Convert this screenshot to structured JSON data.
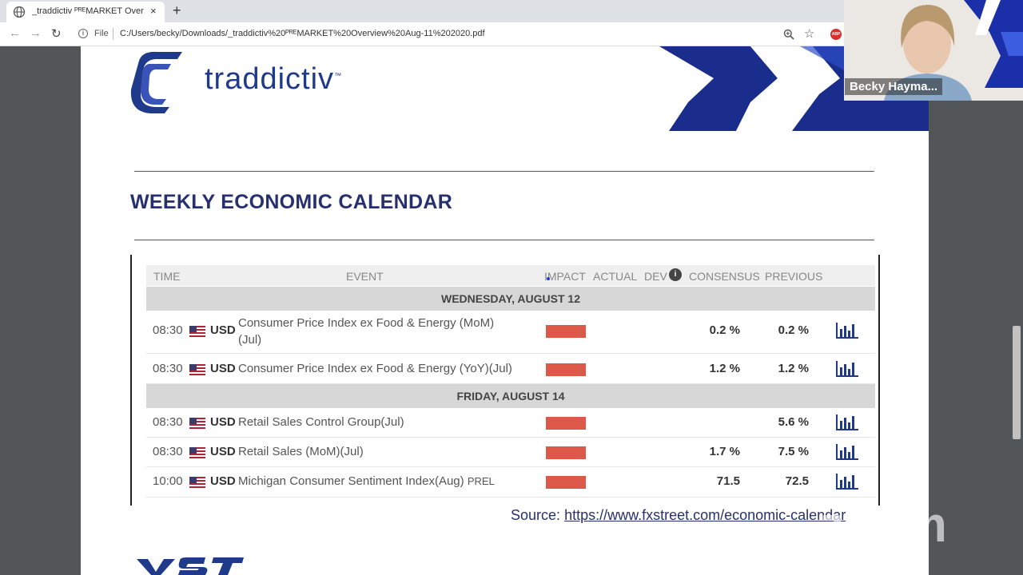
{
  "browser": {
    "tab_title": "_traddictiv ᴾᴿᴱMARKET Overview A",
    "tab_close": "×",
    "new_tab": "+",
    "back": "←",
    "forward": "→",
    "reload": "↻",
    "address_scheme": "File",
    "address_url": "C:/Users/becky/Downloads/_traddictiv%20ᴾᴿᴱMARKET%20Overview%20Aug-11%202020.pdf",
    "abp_label": "ABP"
  },
  "page": {
    "logo_text": "traddictiv",
    "logo_tm": "™",
    "heading": "WEEKLY ECONOMIC CALENDAR",
    "source_label": "Source:",
    "source_url": "https://www.fxstreet.com/economic-calendar"
  },
  "calendar": {
    "headers": {
      "time": "TIME",
      "event": "EVENT",
      "impact": "IMPACT",
      "actual": "ACTUAL",
      "dev": "DEV",
      "consensus": "CONSENSUS",
      "previous": "PREVIOUS"
    },
    "days": [
      {
        "label": "WEDNESDAY, AUGUST 12",
        "events": [
          {
            "time": "08:30",
            "currency": "USD",
            "event": "Consumer Price Index ex Food & Energy (MoM)",
            "event_line2": "(Jul)",
            "tag": "",
            "consensus": "0.2 %",
            "previous": "0.2 %"
          },
          {
            "time": "08:30",
            "currency": "USD",
            "event": "Consumer Price Index ex Food & Energy (YoY)(Jul)",
            "event_line2": "",
            "tag": "",
            "consensus": "1.2 %",
            "previous": "1.2 %"
          }
        ]
      },
      {
        "label": "FRIDAY, AUGUST 14",
        "events": [
          {
            "time": "08:30",
            "currency": "USD",
            "event": "Retail Sales Control Group(Jul)",
            "event_line2": "",
            "tag": "",
            "consensus": "",
            "previous": "5.6 %"
          },
          {
            "time": "08:30",
            "currency": "USD",
            "event": "Retail Sales (MoM)(Jul)",
            "event_line2": "",
            "tag": "",
            "consensus": "1.7 %",
            "previous": "7.5 %"
          },
          {
            "time": "10:00",
            "currency": "USD",
            "event": "Michigan Consumer Sentiment Index(Aug)",
            "event_line2": "",
            "tag": "PREL",
            "consensus": "71.5",
            "previous": "72.5"
          }
        ]
      }
    ]
  },
  "zoom": {
    "participant_name": "Becky Hayma...",
    "watermark": "zoom"
  },
  "colors": {
    "heading": "#27306e",
    "impact_high": "#dd5848",
    "brand_blue": "#1f3a8a"
  }
}
